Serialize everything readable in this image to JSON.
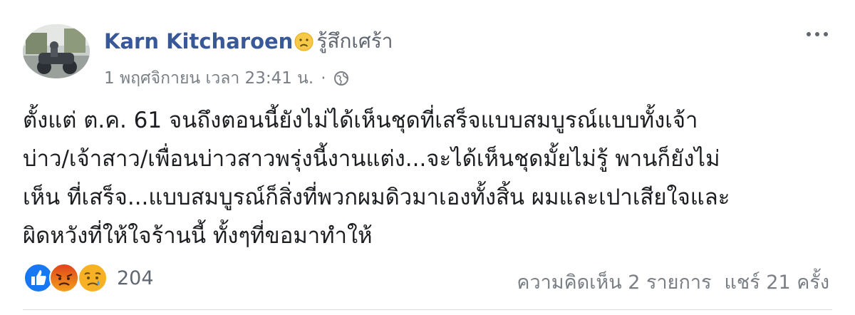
{
  "post": {
    "author": "Karn Kitcharoen",
    "feeling_icon": "sad-face-emoji",
    "feeling": "รู้สึกเศร้า",
    "timestamp": "1 พฤศจิกายน เวลา 23:41 น.",
    "separator": "·",
    "privacy_icon": "globe-icon",
    "message_lines": [
      "ตั้งแต่ ต.ค. 61 จนถึงตอนนี้ยังไม่ได้เห็นชุดที่เสร็จแบบสมบูรณ์แบบทั้งเจ้า",
      "บ่าว/เจ้าสาว/เพื่อนบ่าวสาวพรุ่งนี้งานแต่ง...จะได้เห็นชุดมั้ยไม่รู้ พานก็ยังไม่",
      "เห็น ที่เสร็จ...แบบสมบูรณ์ก็สิ่งที่พวกผมดิวมาเองทั้งสิ้น ผมและเปาเสียใจและ",
      "ผิดหวังที่ให้ใจร้านนี้ ทั้งๆที่ขอมาทำให้"
    ]
  },
  "reactions": {
    "icons": [
      "like-icon",
      "angry-icon",
      "sad-icon"
    ],
    "count": "204"
  },
  "stats": {
    "comments": "ความคิดเห็น 2 รายการ",
    "shares": "แชร์ 21 ครั้ง"
  },
  "colors": {
    "author": "#385898",
    "meta": "#7a7f86",
    "text": "#1c1e21",
    "like": "#1877f2",
    "angry": "#e9710f",
    "sad": "#f7b125"
  }
}
